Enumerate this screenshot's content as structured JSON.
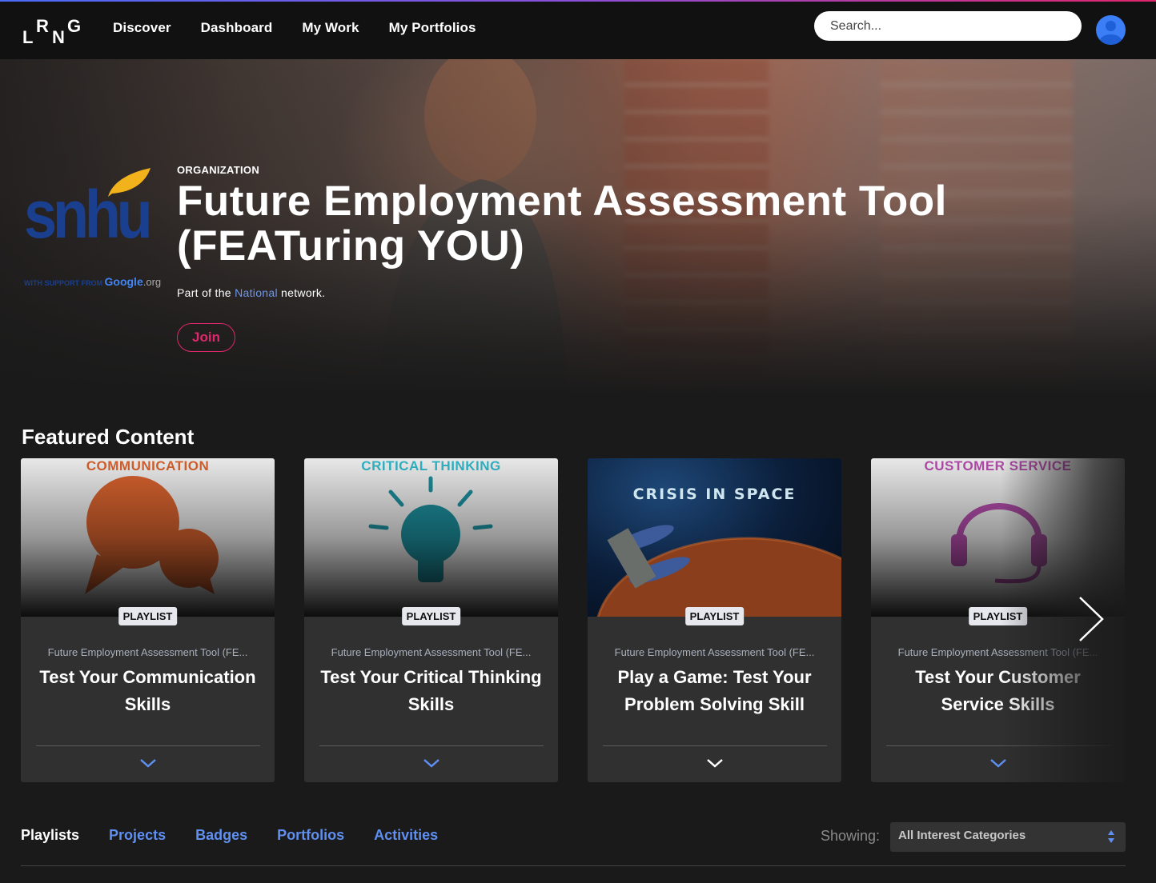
{
  "nav": {
    "logo_letters": [
      "L",
      "R",
      "N",
      "G"
    ],
    "links": [
      "Discover",
      "Dashboard",
      "My Work",
      "My Portfolios"
    ],
    "search_placeholder": "Search...",
    "avatar_icon": "user-avatar-icon"
  },
  "hero": {
    "org_logo": {
      "name": "snhu",
      "support_text": "WITH SUPPORT FROM",
      "google": "Google",
      "google_suffix": ".org"
    },
    "label": "ORGANIZATION",
    "title": "Future Employment Assessment Tool (FEATuring YOU)",
    "network_prefix": "Part of the ",
    "network_link": "National",
    "network_suffix": " network.",
    "join_label": "Join"
  },
  "featured": {
    "heading": "Featured Content",
    "cards": [
      {
        "thumb_title": "COMMUNICATION",
        "thumb_color": "#d2602d",
        "badge": "PLAYLIST",
        "org": "Future Employment Assessment Tool (FE...",
        "title": "Test Your Communication Skills",
        "chevron_color": "#5f8ff0"
      },
      {
        "thumb_title": "CRITICAL THINKING",
        "thumb_color": "#1c8b99",
        "badge": "PLAYLIST",
        "org": "Future Employment Assessment Tool (FE...",
        "title": "Test Your Critical Thinking Skills",
        "chevron_color": "#5f8ff0"
      },
      {
        "thumb_title": "CRISIS IN SPACE",
        "thumb_color": "#cfe6ee",
        "badge": "PLAYLIST",
        "org": "Future Employment Assessment Tool (FE...",
        "title": "Play a Game: Test Your Problem Solving Skill",
        "chevron_color": "#ffffff"
      },
      {
        "thumb_title": "CUSTOMER SERVICE",
        "thumb_color": "#b04ba8",
        "badge": "PLAYLIST",
        "org": "Future Employment Assessment Tool (FE...",
        "title": "Test Your Customer Service Skills",
        "chevron_color": "#5f8ff0"
      }
    ],
    "next_icon": "chevron-right-icon"
  },
  "tabs": {
    "items": [
      "Playlists",
      "Projects",
      "Badges",
      "Portfolios",
      "Activities"
    ],
    "active": "Playlists"
  },
  "filter": {
    "label": "Showing:",
    "selected": "All Interest Categories"
  },
  "colors": {
    "accent_blue": "#5f8ff0",
    "join_pink": "#e0266c",
    "background": "#1a1a1a",
    "nav_bg": "#111111",
    "card_bg": "#303030"
  }
}
